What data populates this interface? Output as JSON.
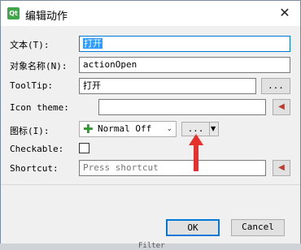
{
  "window": {
    "title": "编辑动作",
    "icon": "qt-designer-icon",
    "close_glyph": "✕"
  },
  "form": {
    "text": {
      "label": "文本(T):",
      "value": "打开"
    },
    "object_name": {
      "label": "对象名称(N):",
      "value": "actionOpen"
    },
    "tooltip": {
      "label": "ToolTip:",
      "value": "打开",
      "button": "..."
    },
    "icon_theme": {
      "label": "Icon theme:",
      "value": ""
    },
    "icon": {
      "label": "图标(I):",
      "mode": "Normal Off",
      "button": "..."
    },
    "checkable": {
      "label": "Checkable:",
      "checked": false
    },
    "shortcut": {
      "label": "Shortcut:",
      "placeholder": "Press shortcut"
    }
  },
  "buttons": {
    "ok": "OK",
    "cancel": "Cancel"
  },
  "background_text": "Filter",
  "colors": {
    "selection": "#3399ff",
    "annotation_arrow": "#e8302a"
  }
}
